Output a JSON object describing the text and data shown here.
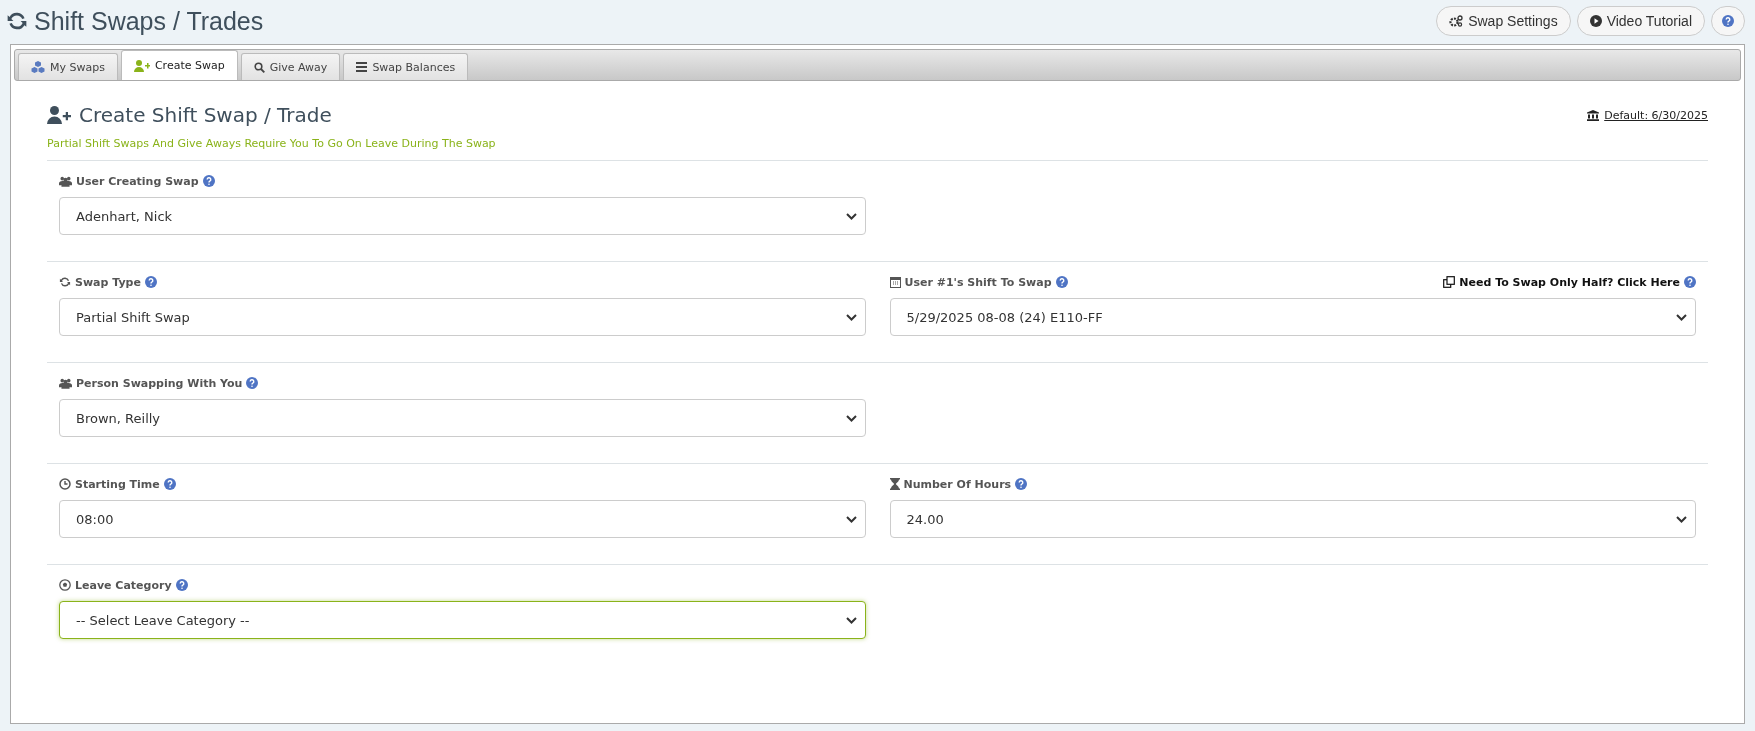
{
  "page": {
    "title": "Shift Swaps / Trades"
  },
  "header_buttons": [
    {
      "label": "Swap Settings"
    },
    {
      "label": "Video Tutorial"
    }
  ],
  "tabs": [
    {
      "label": "My Swaps",
      "selected": false
    },
    {
      "label": "Create Swap",
      "selected": true
    },
    {
      "label": "Give Away",
      "selected": false
    },
    {
      "label": "Swap Balances",
      "selected": false
    }
  ],
  "form": {
    "title": "Create Shift Swap / Trade",
    "notice": "Partial Shift Swaps And Give Aways Require You To Go On Leave During The Swap",
    "default_link": "Default: 6/30/2025",
    "rows": [
      {
        "fields": [
          {
            "label": "User Creating Swap",
            "value": "Adenhart, Nick",
            "focused": false
          }
        ]
      },
      {
        "fields": [
          {
            "label": "Swap Type",
            "value": "Partial Shift Swap",
            "focused": false
          },
          {
            "label": "User #1's Shift To Swap",
            "value": "5/29/2025 08-08 (24) E110-FF",
            "focused": false,
            "link": "Need To Swap Only Half? Click Here"
          }
        ]
      },
      {
        "fields": [
          {
            "label": "Person Swapping With You",
            "value": "Brown, Reilly",
            "focused": false
          }
        ]
      },
      {
        "fields": [
          {
            "label": "Starting Time",
            "value": "08:00",
            "focused": false
          },
          {
            "label": "Number Of Hours",
            "value": "24.00",
            "focused": false
          }
        ]
      },
      {
        "fields": [
          {
            "label": "Leave Category",
            "value": "-- Select Leave Category --",
            "focused": true
          }
        ]
      }
    ]
  }
}
